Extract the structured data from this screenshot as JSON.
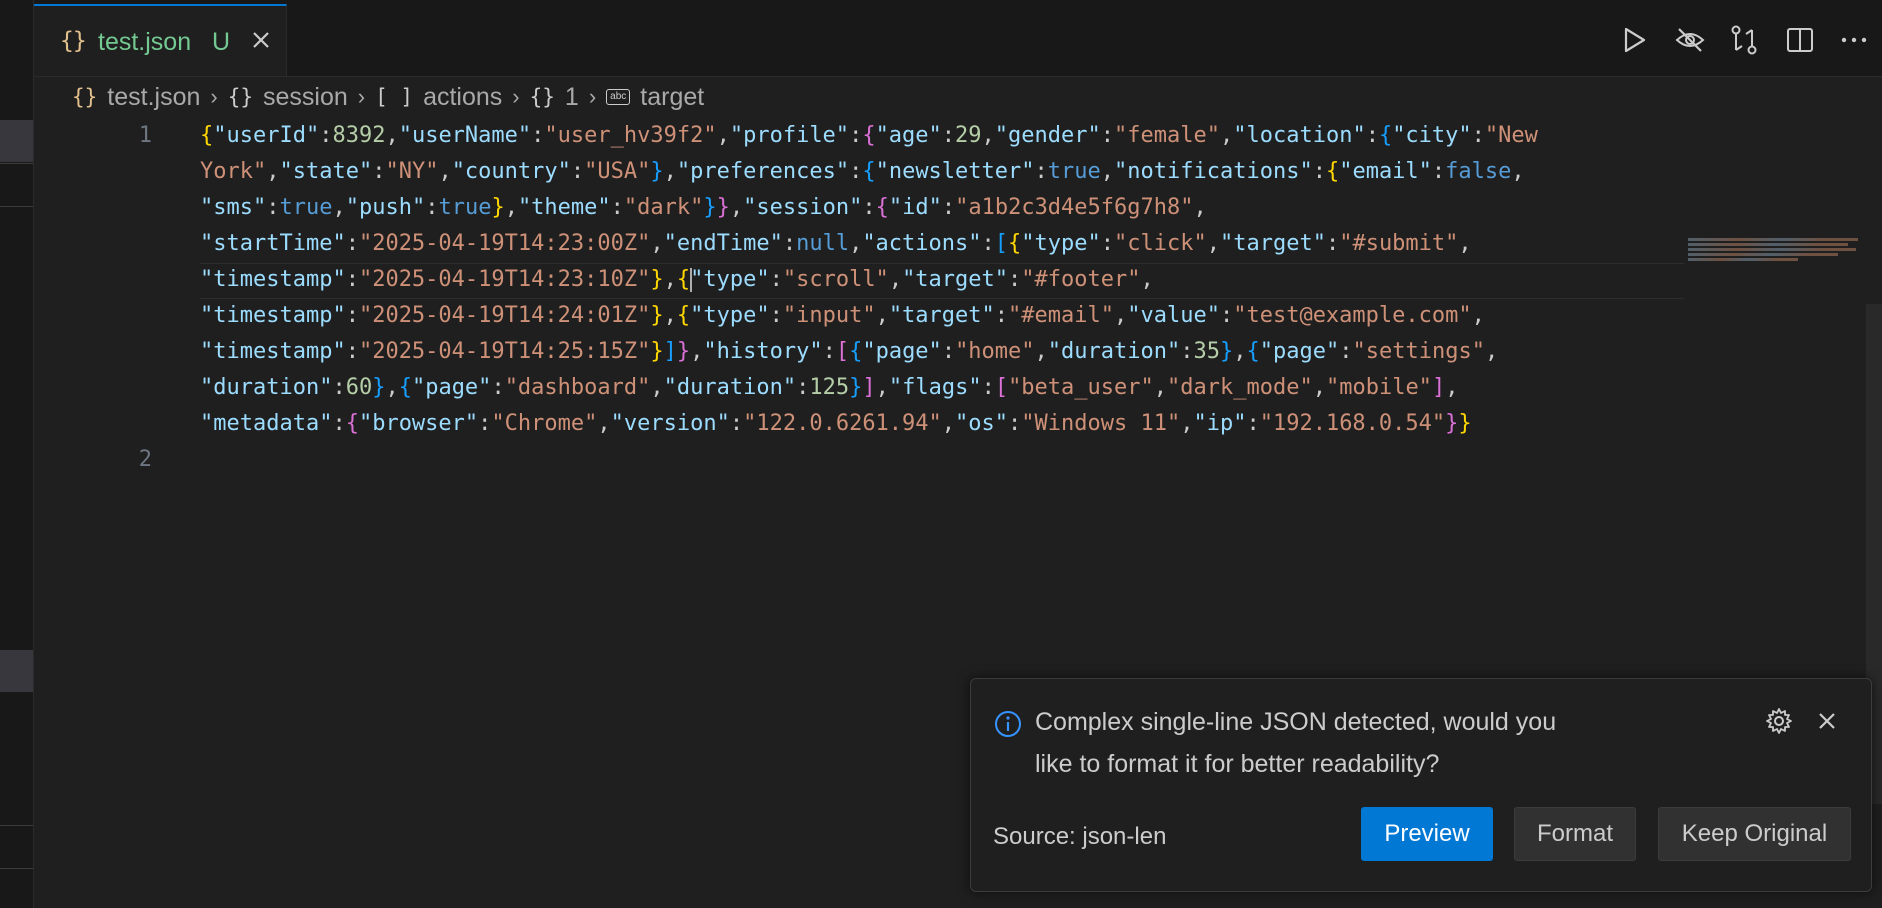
{
  "tab": {
    "icon": "{}",
    "name": "test.json",
    "status": "U"
  },
  "tab_actions": [
    {
      "name": "run-icon"
    },
    {
      "name": "eye-closed-icon"
    },
    {
      "name": "compare-changes-icon"
    },
    {
      "name": "split-editor-icon"
    },
    {
      "name": "more-actions-icon"
    }
  ],
  "breadcrumb": {
    "file_icon": "{}",
    "file": "test.json",
    "i1_icon": "{}",
    "i1": "session",
    "i2_icon": "[ ]",
    "i2": "actions",
    "i3_icon": "{}",
    "i3": "1",
    "i4_icon": "abc",
    "i4": "target"
  },
  "editor": {
    "line_numbers": [
      "1",
      "2"
    ],
    "code_lines": [
      "{\"userId\":8392,\"userName\":\"user_hv39f2\",\"profile\":{\"age\":29,\"gender\":\"female\",\"location\":{\"city\":\"New",
      "York\",\"state\":\"NY\",\"country\":\"USA\"},\"preferences\":{\"newsletter\":true,\"notifications\":{\"email\":false,",
      "\"sms\":true,\"push\":true},\"theme\":\"dark\"}},\"session\":{\"id\":\"a1b2c3d4e5f6g7h8\",",
      "\"startTime\":\"2025-04-19T14:23:00Z\",\"endTime\":null,\"actions\":[{\"type\":\"click\",\"target\":\"#submit\",",
      "\"timestamp\":\"2025-04-19T14:23:10Z\"},{\"type\":\"scroll\",\"target\":\"#footer\",",
      "\"timestamp\":\"2025-04-19T14:24:01Z\"},{\"type\":\"input\",\"target\":\"#email\",\"value\":\"test@example.com\",",
      "\"timestamp\":\"2025-04-19T14:25:15Z\"}]},\"history\":[{\"page\":\"home\",\"duration\":35},{\"page\":\"settings\",",
      "\"duration\":60},{\"page\":\"dashboard\",\"duration\":125}],\"flags\":[\"beta_user\",\"dark_mode\",\"mobile\"],",
      "\"metadata\":{\"browser\":\"Chrome\",\"version\":\"122.0.6261.94\",\"os\":\"Windows 11\",\"ip\":\"192.168.0.54\"}}"
    ],
    "cursor": {
      "line": 1,
      "wrap_row": 5
    }
  },
  "notification": {
    "message": "Complex single-line JSON detected, would you like to format it for better readability?",
    "source": "Source: json-len",
    "buttons": {
      "preview": "Preview",
      "format": "Format",
      "keep": "Keep Original"
    }
  },
  "colors": {
    "key": "#9cdcfe",
    "string": "#ce9178",
    "number": "#b5cea8",
    "keyword": "#569cd6",
    "bracket1": "#ffd700",
    "bracket2": "#da70d6",
    "bracket3": "#179fff",
    "accent": "#0078d4"
  }
}
